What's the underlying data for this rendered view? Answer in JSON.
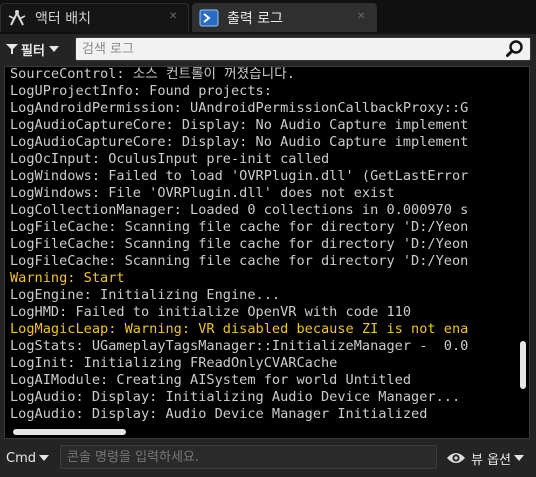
{
  "tabs": [
    {
      "label": "액터 배치",
      "icon": "actor-placement-icon",
      "active": false
    },
    {
      "label": "출력 로그",
      "icon": "output-log-icon",
      "active": true
    }
  ],
  "toolbar": {
    "filter_label": "필터"
  },
  "search": {
    "placeholder": "검색 로그"
  },
  "log_lines": [
    {
      "text": "SourceControl: 소스 컨트롤이 꺼졌습니다.",
      "level": "normal"
    },
    {
      "text": "LogUProjectInfo: Found projects:",
      "level": "normal"
    },
    {
      "text": "LogAndroidPermission: UAndroidPermissionCallbackProxy::G",
      "level": "normal"
    },
    {
      "text": "LogAudioCaptureCore: Display: No Audio Capture implement",
      "level": "normal"
    },
    {
      "text": "LogAudioCaptureCore: Display: No Audio Capture implement",
      "level": "normal"
    },
    {
      "text": "LogOcInput: OculusInput pre-init called",
      "level": "normal"
    },
    {
      "text": "LogWindows: Failed to load 'OVRPlugin.dll' (GetLastError",
      "level": "normal"
    },
    {
      "text": "LogWindows: File 'OVRPlugin.dll' does not exist",
      "level": "normal"
    },
    {
      "text": "LogCollectionManager: Loaded 0 collections in 0.000970 s",
      "level": "normal"
    },
    {
      "text": "LogFileCache: Scanning file cache for directory 'D:/Yeon",
      "level": "normal"
    },
    {
      "text": "LogFileCache: Scanning file cache for directory 'D:/Yeon",
      "level": "normal"
    },
    {
      "text": "LogFileCache: Scanning file cache for directory 'D:/Yeon",
      "level": "normal"
    },
    {
      "text": "Warning: Start",
      "level": "warning"
    },
    {
      "text": "LogEngine: Initializing Engine...",
      "level": "normal"
    },
    {
      "text": "LogHMD: Failed to initialize OpenVR with code 110",
      "level": "normal"
    },
    {
      "text": "LogMagicLeap: Warning: VR disabled because ZI is not ena",
      "level": "warning"
    },
    {
      "text": "LogStats: UGameplayTagsManager::InitializeManager -  0.0",
      "level": "normal"
    },
    {
      "text": "LogInit: Initializing FReadOnlyCVARCache",
      "level": "normal"
    },
    {
      "text": "LogAIModule: Creating AISystem for world Untitled",
      "level": "normal"
    },
    {
      "text": "LogAudio: Display: Initializing Audio Device Manager...",
      "level": "normal"
    },
    {
      "text": "LogAudio: Display: Audio Device Manager Initialized",
      "level": "normal"
    }
  ],
  "console": {
    "cmd_label": "Cmd",
    "placeholder": "콘솔 명령을 입력하세요."
  },
  "view_options": {
    "label": "뷰 옵션"
  },
  "colors": {
    "log_text": "#cccccc",
    "warning_text": "#f2c418",
    "log_background": "#000000"
  }
}
